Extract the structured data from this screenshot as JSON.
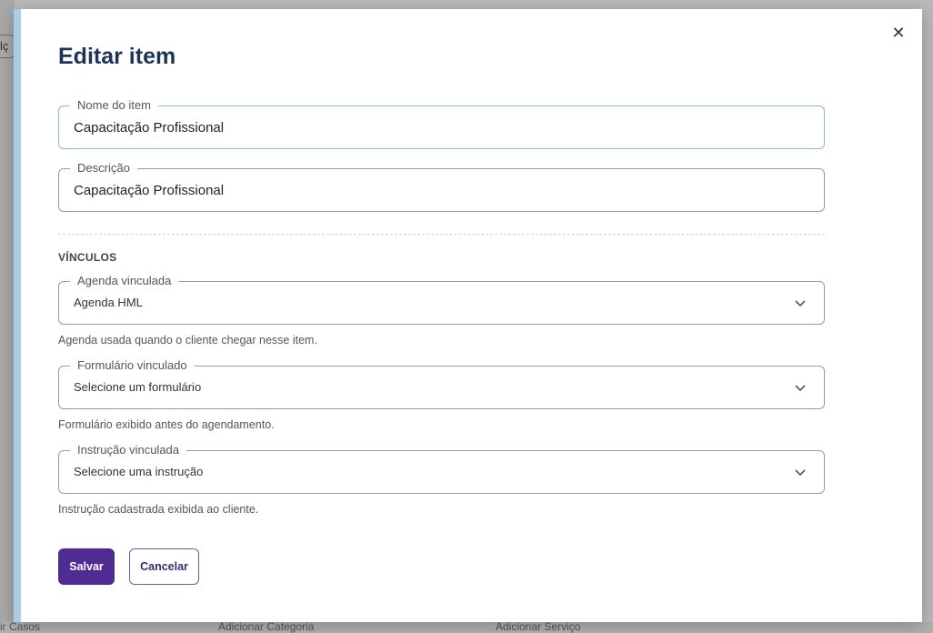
{
  "background": {
    "fragment_text": "lç",
    "bottom_left": "ir Casos",
    "bottom_mid": "Adicionar Categoria",
    "bottom_right": "Adicionar Serviço"
  },
  "modal": {
    "title": "Editar item",
    "close_icon": "close-icon",
    "fields": {
      "name": {
        "label": "Nome do item",
        "value": "Capacitação Profissional"
      },
      "description": {
        "label": "Descrição",
        "value": "Capacitação Profissional"
      }
    },
    "section_label": "VÍNCULOS",
    "links": {
      "agenda": {
        "label": "Agenda vinculada",
        "value": "Agenda HML",
        "helper": "Agenda usada quando o cliente chegar nesse item."
      },
      "form": {
        "label": "Formulário vinculado",
        "value": "Selecione um formulário",
        "helper": "Formulário exibido antes do agendamento."
      },
      "instruction": {
        "label": "Instrução vinculada",
        "value": "Selecione uma instrução",
        "helper": "Instrução cadastrada exibida ao cliente."
      }
    },
    "buttons": {
      "save": "Salvar",
      "cancel": "Cancelar"
    },
    "colors": {
      "accent": "#4f2c91",
      "title": "#1c3556",
      "focus_border": "#8bbbd8"
    }
  }
}
